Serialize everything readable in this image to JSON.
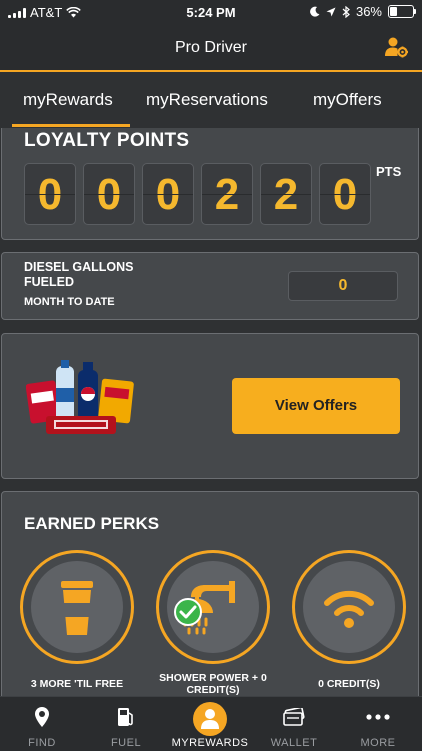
{
  "status_bar": {
    "carrier": "AT&T",
    "time": "5:24 PM",
    "battery": "36%",
    "battery_level": 0.36
  },
  "nav": {
    "title": "Pro Driver",
    "right_icon": "user-gear-icon"
  },
  "tabs": [
    {
      "label": "myRewards",
      "active": true
    },
    {
      "label": "myReservations",
      "active": false
    },
    {
      "label": "myOffers",
      "active": false
    }
  ],
  "loyalty": {
    "title": "LOYALTY POINTS",
    "digits": [
      "0",
      "0",
      "0",
      "2",
      "2",
      "0"
    ],
    "unit": "PTS"
  },
  "diesel": {
    "label": "DIESEL GALLONS FUELED",
    "period": "MONTH TO DATE",
    "value": "0"
  },
  "offers": {
    "image": "snacks-image",
    "button": "View Offers"
  },
  "perks": {
    "title": "EARNED PERKS",
    "items": [
      {
        "icon": "coffee-cup-icon",
        "label": "3 MORE 'TIL FREE"
      },
      {
        "icon": "shower-icon",
        "label": "SHOWER POWER + 0 CREDIT(S)",
        "checked": true
      },
      {
        "icon": "wifi-icon",
        "label": "0 CREDIT(S)"
      }
    ]
  },
  "tabbar": [
    {
      "label": "FIND",
      "icon": "location-pin-icon"
    },
    {
      "label": "FUEL",
      "icon": "fuel-pump-icon"
    },
    {
      "label": "MYREWARDS",
      "icon": "user-icon",
      "active": true
    },
    {
      "label": "WALLET",
      "icon": "wallet-icon"
    },
    {
      "label": "MORE",
      "icon": "more-dots-icon"
    }
  ],
  "colors": {
    "accent": "#f5a623",
    "background": "#2f3133",
    "card": "#45484b"
  }
}
